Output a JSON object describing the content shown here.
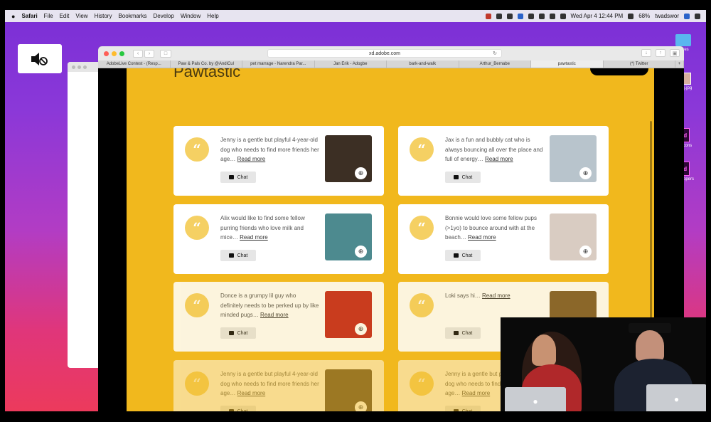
{
  "menubar": {
    "app": "Safari",
    "items": [
      "File",
      "Edit",
      "View",
      "History",
      "Bookmarks",
      "Develop",
      "Window",
      "Help"
    ],
    "datetime": "Wed Apr 4  12:44 PM",
    "battery": "68%",
    "user": "twadswor"
  },
  "desktop": {
    "icons": [
      {
        "label": "Wires",
        "kind": "folder"
      },
      {
        "label": "7e6qj.jpg",
        "kind": "image"
      },
      {
        "label": "eer icons",
        "kind": "xd"
      },
      {
        "label": "be hoppers",
        "kind": "xd"
      }
    ]
  },
  "browser": {
    "url": "xd.adobe.com",
    "tabs": [
      {
        "label": "AdobeLive Contest - (Resp...",
        "active": false
      },
      {
        "label": "Paw & Pals Co. by @AndiCul",
        "active": false
      },
      {
        "label": "pet marrage - Narendra Par...",
        "active": false
      },
      {
        "label": "Jan Erik - Adogbe",
        "active": false
      },
      {
        "label": "bark-and-walk",
        "active": false
      },
      {
        "label": "Arthur_Bernabe",
        "active": false
      },
      {
        "label": "pawtastic",
        "active": true
      },
      {
        "label": "(*) Twitter",
        "active": false
      }
    ],
    "new_tab": "+"
  },
  "page": {
    "heading": "Pawtastic",
    "quote_glyph": "“",
    "zoom_glyph": "⊕",
    "chat_label": "Chat",
    "cards": [
      {
        "text": "Jenny is a gentle but playful 4-year-old dog who needs to find more friends her age…",
        "more": "Read more",
        "photo_color": "#3c2f24"
      },
      {
        "text": "Jax is a fun and bubbly cat who is always bouncing all over the place and full of energy…",
        "more": "Read more",
        "photo_color": "#b8c4cc"
      },
      {
        "text": "Alix would like to find some fellow purring friends who love milk and mice…",
        "more": "Read more",
        "photo_color": "#4d8a8f"
      },
      {
        "text": "Bonnie would love some fellow pups (>1yo) to bounce around with at the beach…",
        "more": "Read more",
        "photo_color": "#d9ccc2"
      },
      {
        "text": "Donce is a grumpy lil guy who definitely needs to be perked up by like minded pugs…",
        "more": "Read more",
        "photo_color": "#c3271f"
      },
      {
        "text": "Loki says hi…",
        "more": "Read more",
        "photo_color": "#7a5a2c"
      },
      {
        "text": "Jenny is a gentle but playful 4-year-old dog who needs to find more friends her age…",
        "more": "Read more",
        "photo_color": "#4a3a2a"
      },
      {
        "text": "Jenny is a gentle but playful 4-year-old dog who needs to find more friends her age…",
        "more": "Read more",
        "photo_color": "#c99a5a"
      }
    ]
  }
}
